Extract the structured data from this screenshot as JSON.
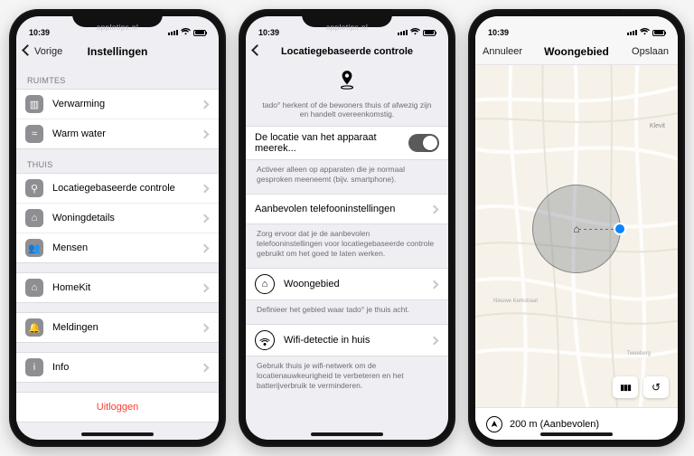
{
  "watermark": "appletips.nl",
  "status_time": "10:39",
  "phone1": {
    "back": "Vorige",
    "title": "Instellingen",
    "section_ruimtes": "RUIMTES",
    "verwarming": "Verwarming",
    "warm_water": "Warm water",
    "section_thuis": "THUIS",
    "locatie": "Locatiegebaseerde controle",
    "woningdetails": "Woningdetails",
    "mensen": "Mensen",
    "homekit": "HomeKit",
    "meldingen": "Meldingen",
    "info": "Info",
    "uitloggen": "Uitloggen"
  },
  "phone2": {
    "title": "Locatiegebaseerde controle",
    "hero": "tado° herkent of de bewoners thuis of afwezig zijn en handelt overeenkomstig.",
    "toggle_label": "De locatie van het apparaat meerek...",
    "toggle_note": "Activeer alleen op apparaten die je normaal gesproken meeneemt (bijv. smartphone).",
    "telefoon": "Aanbevolen telefooninstellingen",
    "telefoon_note": "Zorg ervoor dat je de aanbevolen telefooninstellingen voor locatiegebaseerde controle gebruikt om het goed te laten werken.",
    "woongebied": "Woongebied",
    "woongebied_note": "Definieer het gebied waar tado° je thuis acht.",
    "wifi": "Wifi-detectie in huis",
    "wifi_note": "Gebruik thuis je wifi-netwerk om de locatienauwkeurigheid te verbeteren en het batterijverbruik te verminderen."
  },
  "phone3": {
    "cancel": "Annuleer",
    "title": "Woongebied",
    "save": "Opslaan",
    "location_poi": "Klevit",
    "street": "Nieuwe Kerkstraat",
    "area1": "Tweeberg",
    "radius_label": "200 m (Aanbevolen)",
    "layers_label": "▤",
    "reset_label": "↺"
  }
}
